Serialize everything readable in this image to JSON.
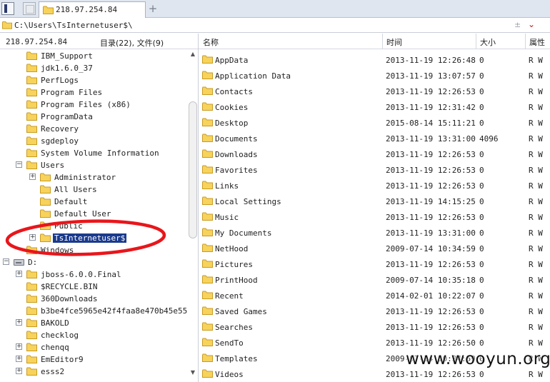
{
  "tab": {
    "label": "218.97.254.84"
  },
  "path": {
    "value": "C:\\Users\\TsInternetuser$\\",
    "controls": "±"
  },
  "left_header": {
    "ip": "218.97.254.84",
    "counts": "目录(22), 文件(9)"
  },
  "columns": {
    "name": "名称",
    "time": "时间",
    "size": "大小",
    "attr": "属性"
  },
  "tree": [
    {
      "label": "IBM_Support",
      "depth": 0,
      "expander": ""
    },
    {
      "label": "jdk1.6.0_37",
      "depth": 0,
      "expander": ""
    },
    {
      "label": "PerfLogs",
      "depth": 0,
      "expander": ""
    },
    {
      "label": "Program Files",
      "depth": 0,
      "expander": ""
    },
    {
      "label": "Program Files (x86)",
      "depth": 0,
      "expander": ""
    },
    {
      "label": "ProgramData",
      "depth": 0,
      "expander": ""
    },
    {
      "label": "Recovery",
      "depth": 0,
      "expander": ""
    },
    {
      "label": "sgdeploy",
      "depth": 0,
      "expander": ""
    },
    {
      "label": "System Volume Information",
      "depth": 0,
      "expander": ""
    },
    {
      "label": "Users",
      "depth": 0,
      "expander": "−"
    },
    {
      "label": "Administrator",
      "depth": 1,
      "expander": "+"
    },
    {
      "label": "All Users",
      "depth": 1,
      "expander": ""
    },
    {
      "label": "Default",
      "depth": 1,
      "expander": ""
    },
    {
      "label": "Default User",
      "depth": 1,
      "expander": ""
    },
    {
      "label": "Public",
      "depth": 1,
      "expander": ""
    },
    {
      "label": "TsInternetuser$",
      "depth": 1,
      "expander": "+",
      "selected": true
    },
    {
      "label": "Windows",
      "depth": 0,
      "expander": ""
    },
    {
      "label": "D:",
      "depth": -1,
      "expander": "−",
      "drive": true
    },
    {
      "label": "jboss-6.0.0.Final",
      "depth": 0,
      "expander": "+"
    },
    {
      "label": "$RECYCLE.BIN",
      "depth": 0,
      "expander": ""
    },
    {
      "label": "360Downloads",
      "depth": 0,
      "expander": ""
    },
    {
      "label": "b3be4fce5965e42f4faa8e470b45e552",
      "depth": 0,
      "expander": ""
    },
    {
      "label": "BAKOLD",
      "depth": 0,
      "expander": "+"
    },
    {
      "label": "checklog",
      "depth": 0,
      "expander": ""
    },
    {
      "label": "chenqq",
      "depth": 0,
      "expander": "+"
    },
    {
      "label": "EmEditor9",
      "depth": 0,
      "expander": "+"
    },
    {
      "label": "esss2",
      "depth": 0,
      "expander": "+"
    }
  ],
  "files": [
    {
      "name": "AppData",
      "time": "2013-11-19 12:26:48",
      "size": "0",
      "attr": "R W"
    },
    {
      "name": "Application Data",
      "time": "2013-11-19 13:07:57",
      "size": "0",
      "attr": "R W"
    },
    {
      "name": "Contacts",
      "time": "2013-11-19 12:26:53",
      "size": "0",
      "attr": "R W"
    },
    {
      "name": "Cookies",
      "time": "2013-11-19 12:31:42",
      "size": "0",
      "attr": "R W"
    },
    {
      "name": "Desktop",
      "time": "2015-08-14 15:11:21",
      "size": "0",
      "attr": "R W"
    },
    {
      "name": "Documents",
      "time": "2013-11-19 13:31:00",
      "size": "4096",
      "attr": "R W"
    },
    {
      "name": "Downloads",
      "time": "2013-11-19 12:26:53",
      "size": "0",
      "attr": "R W"
    },
    {
      "name": "Favorites",
      "time": "2013-11-19 12:26:53",
      "size": "0",
      "attr": "R W"
    },
    {
      "name": "Links",
      "time": "2013-11-19 12:26:53",
      "size": "0",
      "attr": "R W"
    },
    {
      "name": "Local Settings",
      "time": "2013-11-19 14:15:25",
      "size": "0",
      "attr": "R W"
    },
    {
      "name": "Music",
      "time": "2013-11-19 12:26:53",
      "size": "0",
      "attr": "R W"
    },
    {
      "name": "My Documents",
      "time": "2013-11-19 13:31:00",
      "size": "0",
      "attr": "R W"
    },
    {
      "name": "NetHood",
      "time": "2009-07-14 10:34:59",
      "size": "0",
      "attr": "R W"
    },
    {
      "name": "Pictures",
      "time": "2013-11-19 12:26:53",
      "size": "0",
      "attr": "R W"
    },
    {
      "name": "PrintHood",
      "time": "2009-07-14 10:35:18",
      "size": "0",
      "attr": "R W"
    },
    {
      "name": "Recent",
      "time": "2014-02-01 10:22:07",
      "size": "0",
      "attr": "R W"
    },
    {
      "name": "Saved Games",
      "time": "2013-11-19 12:26:53",
      "size": "0",
      "attr": "R W"
    },
    {
      "name": "Searches",
      "time": "2013-11-19 12:26:53",
      "size": "0",
      "attr": "R W"
    },
    {
      "name": "SendTo",
      "time": "2013-11-19 12:26:50",
      "size": "0",
      "attr": "R W"
    },
    {
      "name": "Templates",
      "time": "2009-07-14 10:34:59",
      "size": "0",
      "attr": "R W"
    },
    {
      "name": "Videos",
      "time": "2013-11-19 12:26:53",
      "size": "0",
      "attr": "R W"
    }
  ],
  "watermark": "www.wooyun.org",
  "colors": {
    "folder": "#f7d35c",
    "folder_edge": "#c89b22",
    "selection": "#1a3a8c",
    "annotation": "#e8161b"
  }
}
